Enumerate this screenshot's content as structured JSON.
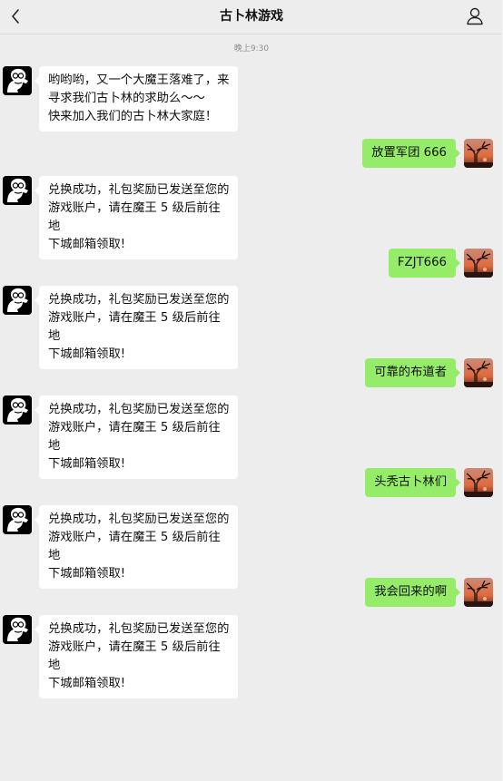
{
  "header": {
    "title": "古卜林游戏",
    "back_icon": "chevron-left-icon",
    "profile_icon": "person-icon"
  },
  "timestamp": "晚上9:30",
  "colors": {
    "background": "#ededed",
    "incoming_bubble": "#ffffff",
    "outgoing_bubble": "#95ec69"
  },
  "messages": [
    {
      "from": "bot",
      "lines": [
        "哟哟哟，又一个大魔王落难了，来",
        "寻求我们古卜林的求助么～～",
        "快来加入我们的古卜林大家庭！"
      ]
    },
    {
      "from": "me",
      "text": "放置军团 666"
    },
    {
      "from": "bot",
      "lines": [
        "兑换成功，礼包奖励已发送至您的",
        "游戏账户，请在魔王 5 级后前往地",
        "下城邮箱领取!"
      ]
    },
    {
      "from": "me",
      "text": "FZJT666"
    },
    {
      "from": "bot",
      "lines": [
        "兑换成功，礼包奖励已发送至您的",
        "游戏账户，请在魔王 5 级后前往地",
        "下城邮箱领取!"
      ]
    },
    {
      "from": "me",
      "text": "可靠的布道者"
    },
    {
      "from": "bot",
      "lines": [
        "兑换成功，礼包奖励已发送至您的",
        "游戏账户，请在魔王 5 级后前往地",
        "下城邮箱领取!"
      ]
    },
    {
      "from": "me",
      "text": "头秃古卜林们"
    },
    {
      "from": "bot",
      "lines": [
        "兑换成功，礼包奖励已发送至您的",
        "游戏账户，请在魔王 5 级后前往地",
        "下城邮箱领取!"
      ]
    },
    {
      "from": "me",
      "text": "我会回来的啊"
    },
    {
      "from": "bot",
      "lines": [
        "兑换成功，礼包奖励已发送至您的",
        "游戏账户，请在魔王 5 级后前往地",
        "下城邮箱领取!"
      ]
    }
  ]
}
